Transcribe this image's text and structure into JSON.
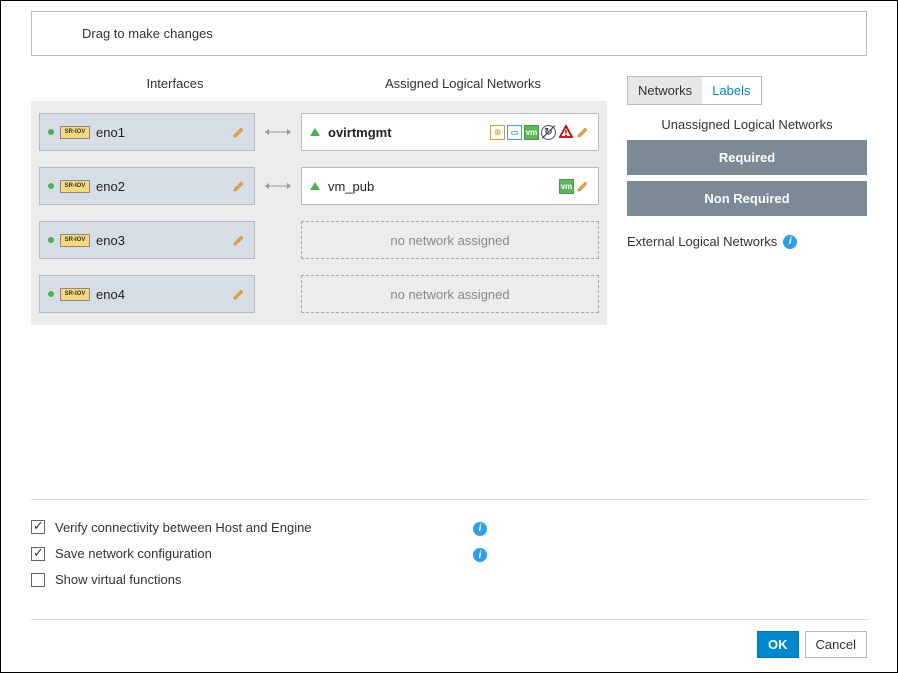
{
  "hint": "Drag to make changes",
  "columns": {
    "interfaces": "Interfaces",
    "assigned": "Assigned Logical Networks"
  },
  "interfaces": [
    {
      "name": "eno1",
      "network": {
        "name": "ovirtmgmt",
        "bold": true,
        "icons": [
          "crown",
          "monitor",
          "vm",
          "sync",
          "warn",
          "pencil"
        ]
      }
    },
    {
      "name": "eno2",
      "network": {
        "name": "vm_pub",
        "bold": false,
        "icons": [
          "vm",
          "pencil"
        ]
      }
    },
    {
      "name": "eno3",
      "empty": "no network assigned"
    },
    {
      "name": "eno4",
      "empty": "no network assigned"
    }
  ],
  "tabs": {
    "networks": "Networks",
    "labels": "Labels",
    "active": "networks"
  },
  "unassigned": {
    "title": "Unassigned Logical Networks",
    "required": "Required",
    "non_required": "Non Required"
  },
  "external": "External Logical Networks",
  "options": {
    "verify": {
      "label": "Verify connectivity between Host and Engine",
      "checked": true,
      "info": true
    },
    "save": {
      "label": "Save network configuration",
      "checked": true,
      "info": true
    },
    "show_vf": {
      "label": "Show virtual functions",
      "checked": false,
      "info": false
    }
  },
  "buttons": {
    "ok": "OK",
    "cancel": "Cancel"
  }
}
